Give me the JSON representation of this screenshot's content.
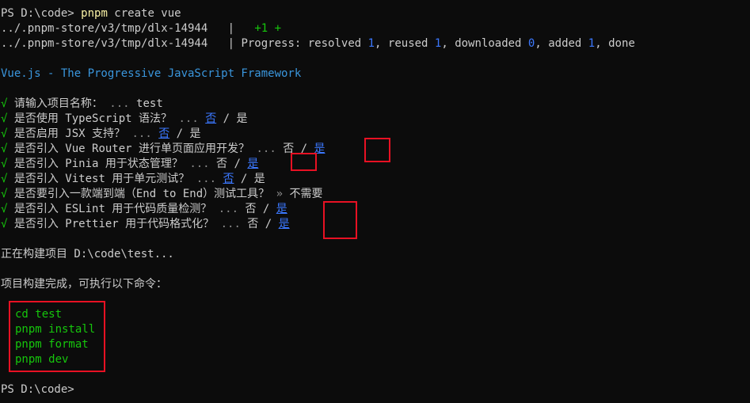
{
  "terminal": {
    "lines": [
      {
        "prompt": "PS D:\\code> ",
        "cmd": "pnpm",
        "args": " create vue"
      },
      {
        "path": "../.pnpm-store/v3/tmp/dlx-14944",
        "sep": "   |   ",
        "plus": "+1",
        "plus2": " +"
      },
      {
        "path": "../.pnpm-store/v3/tmp/dlx-14944",
        "sep": "   | ",
        "p1": "Progress: resolved ",
        "n1": "1",
        "p2": ", reused ",
        "n2": "1",
        "p3": ", downloaded ",
        "n3": "0",
        "p4": ", added ",
        "n4": "1",
        "p5": ", done"
      }
    ],
    "banner": "Vue.js - The Progressive JavaScript Framework",
    "check": "√",
    "questions": [
      {
        "q": "请输入项目名称：",
        "dots": " ... ",
        "answer": "test"
      },
      {
        "q": "是否使用 TypeScript 语法？",
        "dots": " ... ",
        "no": "否",
        "slash": " / ",
        "yes": "是",
        "selected": "no"
      },
      {
        "q": "是否启用 JSX 支持？",
        "dots": " ... ",
        "no": "否",
        "slash": " / ",
        "yes": "是",
        "selected": "no"
      },
      {
        "q": "是否引入 Vue Router 进行单页面应用开发？",
        "dots": " ... ",
        "no": "否",
        "slash": " / ",
        "yes": "是",
        "selected": "yes"
      },
      {
        "q": "是否引入 Pinia 用于状态管理？",
        "dots": " ... ",
        "no": "否",
        "slash": " / ",
        "yes": "是",
        "selected": "yes"
      },
      {
        "q": "是否引入 Vitest 用于单元测试？",
        "dots": " ... ",
        "no": "否",
        "slash": " / ",
        "yes": "是",
        "selected": "no"
      },
      {
        "q": "是否要引入一款端到端（End to End）测试工具？",
        "dots": " » ",
        "answer": "不需要"
      },
      {
        "q": "是否引入 ESLint 用于代码质量检测？",
        "dots": " ... ",
        "no": "否",
        "slash": " / ",
        "yes": "是",
        "selected": "yes"
      },
      {
        "q": "是否引入 Prettier 用于代码格式化？",
        "dots": " ... ",
        "no": "否",
        "slash": " / ",
        "yes": "是",
        "selected": "yes"
      }
    ],
    "building": "正在构建项目 D:\\code\\test...",
    "done": "项目构建完成，可执行以下命令：",
    "commands": [
      "cd test",
      "pnpm install",
      "pnpm format",
      "pnpm dev"
    ],
    "final_prompt": "PS D:\\code>"
  },
  "colors": {
    "background": "#0c0c0c",
    "text": "#cccccc",
    "command": "#f9f1a5",
    "success": "#16c60c",
    "banner": "#3a96dd",
    "selected": "#3b78ff",
    "highlight_box": "#e81123"
  }
}
